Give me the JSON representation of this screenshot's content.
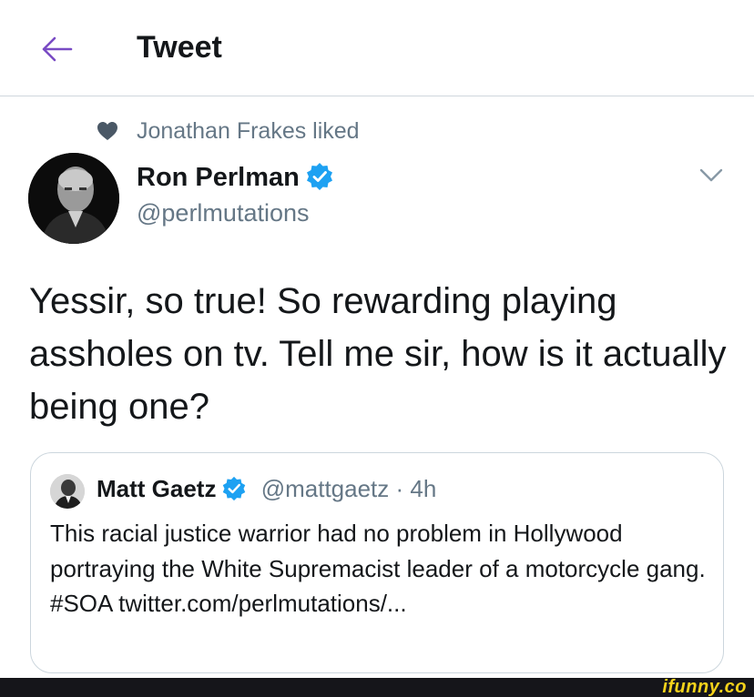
{
  "header": {
    "title": "Tweet",
    "back_icon": "arrow-left-icon",
    "accent_color": "#794bc4"
  },
  "social_context": {
    "text": "Jonathan Frakes liked",
    "icon": "heart-icon"
  },
  "tweet": {
    "author_name": "Ron Perlman",
    "author_handle": "@perlmutations",
    "verified": true,
    "text": "Yessir, so true! So rewarding playing assholes on tv. Tell me sir, how is it actually being one?"
  },
  "quoted_tweet": {
    "author_name": "Matt Gaetz",
    "author_handle": "@mattgaetz",
    "separator": "·",
    "time": "4h",
    "verified": true,
    "text": "This racial justice warrior had no problem in Hollywood portraying the White Supremacist leader of a motorcycle gang. #SOA twitter.com/perlmutations/..."
  },
  "footer": {
    "watermark": "ifunny.co"
  },
  "colors": {
    "verified": "#1da1f2",
    "secondary_text": "#657786",
    "border": "#ccd6dd"
  }
}
